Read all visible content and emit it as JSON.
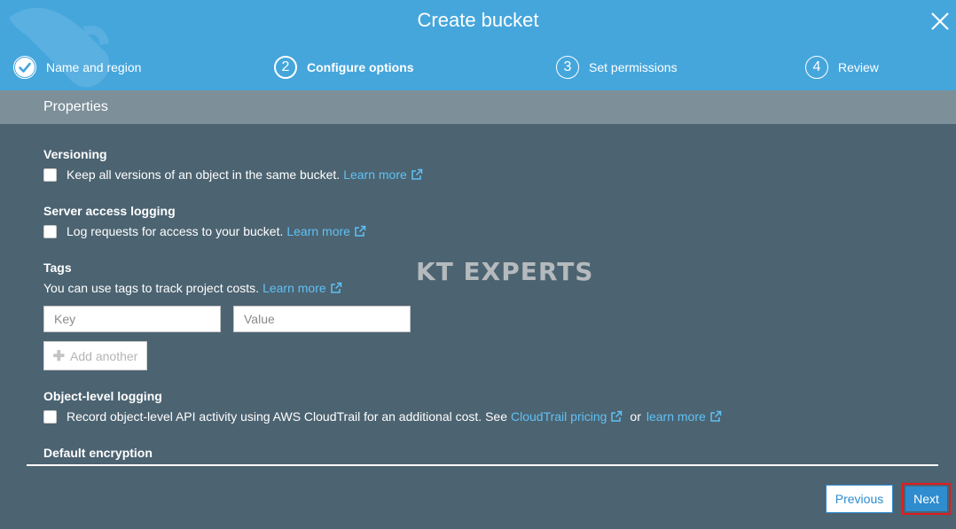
{
  "modal": {
    "title": "Create bucket"
  },
  "steps": [
    {
      "number": "",
      "label": "Name and region",
      "state": "complete"
    },
    {
      "number": "2",
      "label": "Configure options",
      "state": "active"
    },
    {
      "number": "3",
      "label": "Set permissions",
      "state": "upcoming"
    },
    {
      "number": "4",
      "label": "Review",
      "state": "upcoming"
    }
  ],
  "properties": {
    "title": "Properties"
  },
  "versioning": {
    "title": "Versioning",
    "checkbox_label": "Keep all versions of an object in the same bucket.",
    "checked": false,
    "link": "Learn more"
  },
  "logging": {
    "title": "Server access logging",
    "checkbox_label": "Log requests for access to your bucket.",
    "checked": false,
    "link": "Learn more"
  },
  "tags": {
    "title": "Tags",
    "description": "You can use tags to track project costs.",
    "link": "Learn more",
    "key_placeholder": "Key",
    "value_placeholder": "Value",
    "key_value": "",
    "value_value": "",
    "add_label": "Add another"
  },
  "object_logging": {
    "title": "Object-level logging",
    "checkbox_label": "Record object-level API activity using AWS CloudTrail for an additional cost. See",
    "checked": false,
    "link1": "CloudTrail pricing",
    "or": "or",
    "link2": "learn more"
  },
  "encryption": {
    "title": "Default encryption"
  },
  "watermark": "KT EXPERTS",
  "footer": {
    "previous_label": "Previous",
    "next_label": "Next"
  },
  "colors": {
    "header": "#45a6dc",
    "body": "#4c6371",
    "properties_bar": "#7d8f99",
    "link": "#5fc2f5",
    "primary_button": "#2e8ccf",
    "highlight_border": "#e11b22"
  },
  "icons": {
    "close": "close-icon",
    "step_complete": "check-icon",
    "external_link": "external-link-icon",
    "add": "plus-icon"
  }
}
